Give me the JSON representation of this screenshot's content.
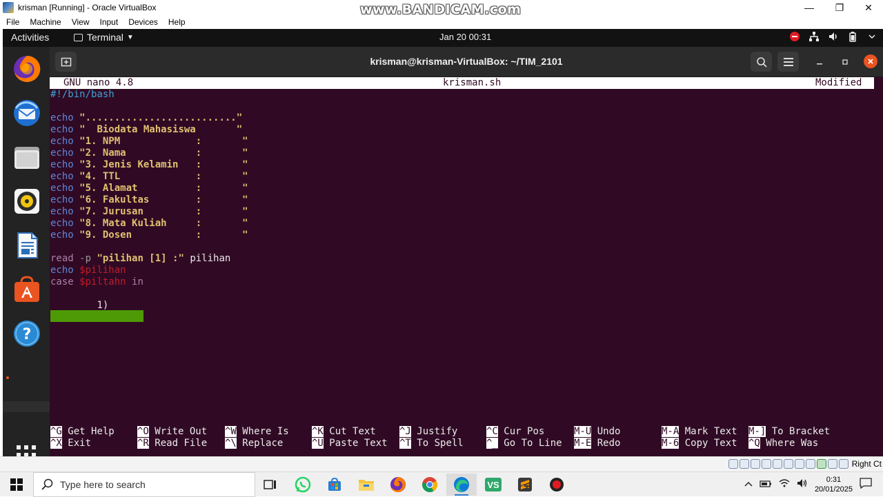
{
  "host_window": {
    "title": "krisman [Running] - Oracle VirtualBox",
    "watermark": "www.BANDICAM.com",
    "controls": {
      "minimize": "—",
      "restore": "❐",
      "close": "✕"
    }
  },
  "host_menu": [
    "File",
    "Machine",
    "View",
    "Input",
    "Devices",
    "Help"
  ],
  "gnome_topbar": {
    "activities": "Activities",
    "app_menu": "Terminal",
    "clock": "Jan 20  00:31"
  },
  "dock": {
    "apps": [
      "firefox-icon",
      "thunderbird-icon",
      "files-icon",
      "rhythmbox-icon",
      "libreoffice-writer-icon",
      "software-icon",
      "help-icon"
    ]
  },
  "terminal": {
    "title": "krisman@krisman-VirtualBox: ~/TIM_2101",
    "new_tab_icon": "⊞",
    "search_icon": "⌕",
    "menu_icon": "☰"
  },
  "nano": {
    "version": "GNU nano 4.8",
    "filename": "krisman.sh",
    "status": "Modified",
    "lines": {
      "shebang": "#!/bin/bash",
      "echo_kw": "echo",
      "l1": "\"..........................\"",
      "l2": "\"  Biodata Mahasiswa       \"",
      "l3": "\"1. NPM             :       \"",
      "l4": "\"2. Nama            :       \"",
      "l5": "\"3. Jenis Kelamin   :       \"",
      "l6": "\"4. TTL             :       \"",
      "l7": "\"5. Alamat          :       \"",
      "l8": "\"6. Fakultas        :       \"",
      "l9": "\"7. Jurusan         :       \"",
      "l10": "\"8. Mata Kuliah     :       \"",
      "l11": "\"9. Dosen           :       \"",
      "read_kw": "read",
      "read_flag": "-p",
      "read_str": "\"pilihan [1] :\"",
      "read_var": "pilihan",
      "echo_var": "$pilihan",
      "case_kw": "case",
      "case_var": "$piltahn",
      "in_kw": "in",
      "case1": "1)"
    },
    "shortcuts": [
      {
        "key1": "^G",
        "label1": "Get Help",
        "key2": "^X",
        "label2": "Exit"
      },
      {
        "key1": "^O",
        "label1": "Write Out",
        "key2": "^R",
        "label2": "Read File"
      },
      {
        "key1": "^W",
        "label1": "Where Is",
        "key2": "^\\",
        "label2": "Replace"
      },
      {
        "key1": "^K",
        "label1": "Cut Text",
        "key2": "^U",
        "label2": "Paste Text"
      },
      {
        "key1": "^J",
        "label1": "Justify",
        "key2": "^T",
        "label2": "To Spell"
      },
      {
        "key1": "^C",
        "label1": "Cur Pos",
        "key2": "^_",
        "label2": "Go To Line"
      },
      {
        "key1": "M-U",
        "label1": "Undo",
        "key2": "M-E",
        "label2": "Redo"
      },
      {
        "key1": "M-A",
        "label1": "Mark Text",
        "key2": "M-6",
        "label2": "Copy Text"
      },
      {
        "key1": "M-]",
        "label1": "To Bracket",
        "key2": "^Q",
        "label2": "Where Was"
      }
    ]
  },
  "vm_status": {
    "host_key": "Right Ct"
  },
  "taskbar": {
    "search_placeholder": "Type here to search",
    "time": "0:31",
    "date": "20/01/2025"
  },
  "colors": {
    "terminal_bg": "#300a24",
    "ubuntu_orange": "#e95420",
    "nano_keyword": "#5f87d7",
    "nano_string": "#e0c070",
    "nano_highlight": "#4e9a06"
  }
}
